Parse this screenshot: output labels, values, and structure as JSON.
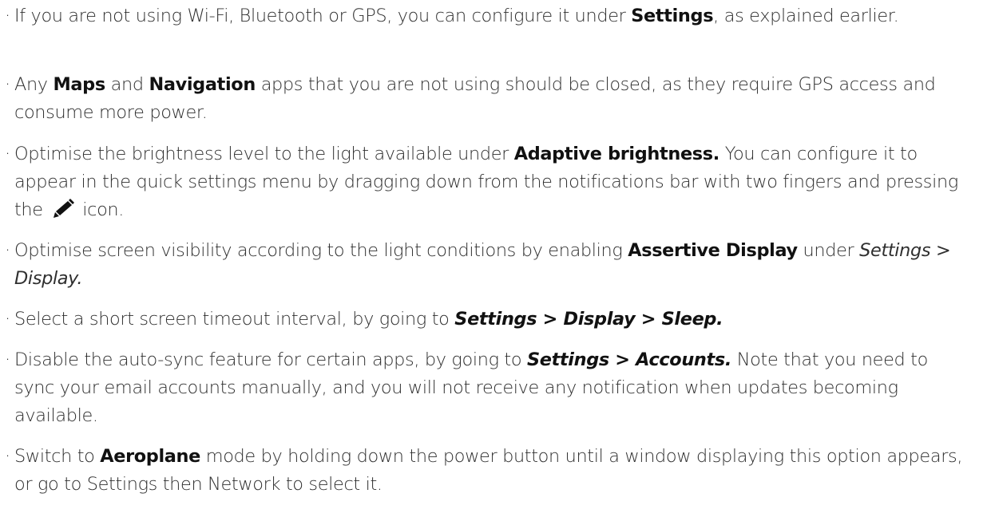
{
  "bullet_char": "·",
  "items": [
    {
      "segments": [
        {
          "t": "If you are not using Wi-Fi, Bluetooth or GPS, you can configure it under ",
          "s": "n"
        },
        {
          "t": "Settings",
          "s": "b"
        },
        {
          "t": ", as explained earlier.",
          "s": "n"
        }
      ]
    },
    {
      "segments": [
        {
          "t": "Any ",
          "s": "n"
        },
        {
          "t": "Maps",
          "s": "b"
        },
        {
          "t": " and ",
          "s": "n"
        },
        {
          "t": "Navigation",
          "s": "b"
        },
        {
          "t": " apps that you are not using should be closed, as they require GPS access and consume more power.",
          "s": "n"
        }
      ]
    },
    {
      "segments": [
        {
          "t": "Optimise the brightness level to the light available under ",
          "s": "n"
        },
        {
          "t": "Adaptive brightness.",
          "s": "b"
        },
        {
          "t": " You can configure it to appear in the quick settings menu by dragging down from the notifications bar with two fingers and pressing the ",
          "s": "n"
        },
        {
          "icon": "pencil-icon"
        },
        {
          "t": " icon.",
          "s": "n"
        }
      ]
    },
    {
      "segments": [
        {
          "t": "Optimise screen visibility according to the light conditions by enabling ",
          "s": "n"
        },
        {
          "t": "Assertive Display",
          "s": "b"
        },
        {
          "t": " under ",
          "s": "n"
        },
        {
          "t": "Settings > Display.",
          "s": "i"
        }
      ]
    },
    {
      "segments": [
        {
          "t": "Select a short screen timeout interval, by going to ",
          "s": "n"
        },
        {
          "t": "Settings > Display > Sleep.",
          "s": "bi"
        }
      ]
    },
    {
      "segments": [
        {
          "t": "Disable the auto-sync feature for certain apps, by going to ",
          "s": "n"
        },
        {
          "t": "Settings > Accounts.",
          "s": "bi"
        },
        {
          "t": " Note that you need to sync your email accounts manually, and you will not receive any notification when updates becoming available.",
          "s": "n"
        }
      ]
    },
    {
      "segments": [
        {
          "t": "Switch to ",
          "s": "n"
        },
        {
          "t": "Aeroplane",
          "s": "b"
        },
        {
          "t": " mode by holding down the power button until a window displaying this option appears, or go to Settings then Network to select it.",
          "s": "n"
        }
      ]
    }
  ]
}
